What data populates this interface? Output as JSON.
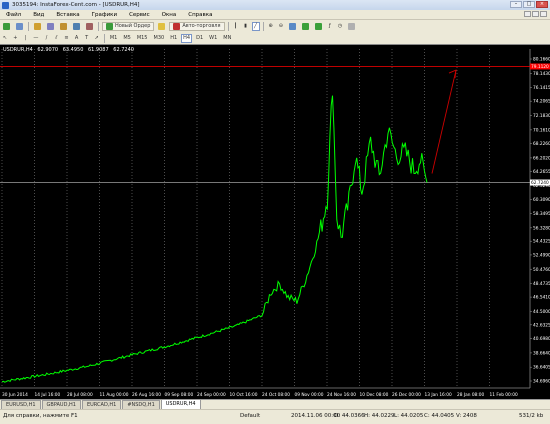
{
  "window": {
    "title": "3035194: InstaForex-Cent.com - [USDRUR,H4]"
  },
  "menu": [
    "Файл",
    "Вид",
    "Вставка",
    "Графики",
    "Сервис",
    "Окна",
    "Справка"
  ],
  "toolbar": {
    "new_order": "Новый Ордер",
    "auto_trading": "Авто-торговля"
  },
  "timeframes": [
    "M1",
    "M5",
    "M15",
    "M30",
    "H1",
    "H4",
    "D1",
    "W1",
    "MN"
  ],
  "active_timeframe": "H4",
  "chart": {
    "label": [
      "USDRUR,H4",
      "62.9070",
      "63.4950",
      "61.9087",
      "62.7240"
    ],
    "price_labels": [
      "80.1660",
      "78.1430",
      "76.1415",
      "74.2065",
      "72.1830",
      "70.1610",
      "68.2260",
      "66.2020",
      "64.2655",
      "62.3290",
      "60.3090",
      "58.3495",
      "56.3280",
      "54.4325",
      "52.4990",
      "50.4760",
      "48.4735",
      "46.5410",
      "44.5000",
      "42.6325",
      "40.6980",
      "38.6640",
      "36.6405",
      "34.6960"
    ],
    "time_labels": [
      "30 Jun 2014",
      "14 Jul 16:00",
      "28 Jul 08:00",
      "11 Aug 00:00",
      "26 Aug 16:00",
      "09 Sep 08:00",
      "24 Sep 00:00",
      "10 Oct 16:00",
      "24 Oct 08:00",
      "09 Nov 00:00",
      "24 Nov 16:00",
      "10 Dec 08:00",
      "26 Dec 00:00",
      "13 Jan 16:00",
      "28 Jan 08:00",
      "11 Feb 00:00"
    ],
    "current_price": "62.7240",
    "resistance_price": "79.1120",
    "colors": {
      "background": "#000000",
      "line": "#00ff00",
      "grid": "#808080",
      "resistance": "#ff0000",
      "arrow": "#cc0000",
      "text": "#ffffff",
      "bid": "#c0c0c0"
    }
  },
  "tabs": [
    "EURUSD,H1",
    "GBPAUD,H1",
    "EURCAD,H1",
    "#NSDQ,H1",
    "USDRUR,H4"
  ],
  "active_tab": "USDRUR,H4",
  "status": {
    "help": "Для справки, нажмите F1",
    "profile": "Default",
    "datetime": "2014.11.06 00:00",
    "open": "O: 44.0366",
    "high": "H: 44.0229",
    "low": "L: 44.0205",
    "close": "C: 44.0405",
    "volume": "V: 2408",
    "traffic": "531/2 kb"
  }
}
